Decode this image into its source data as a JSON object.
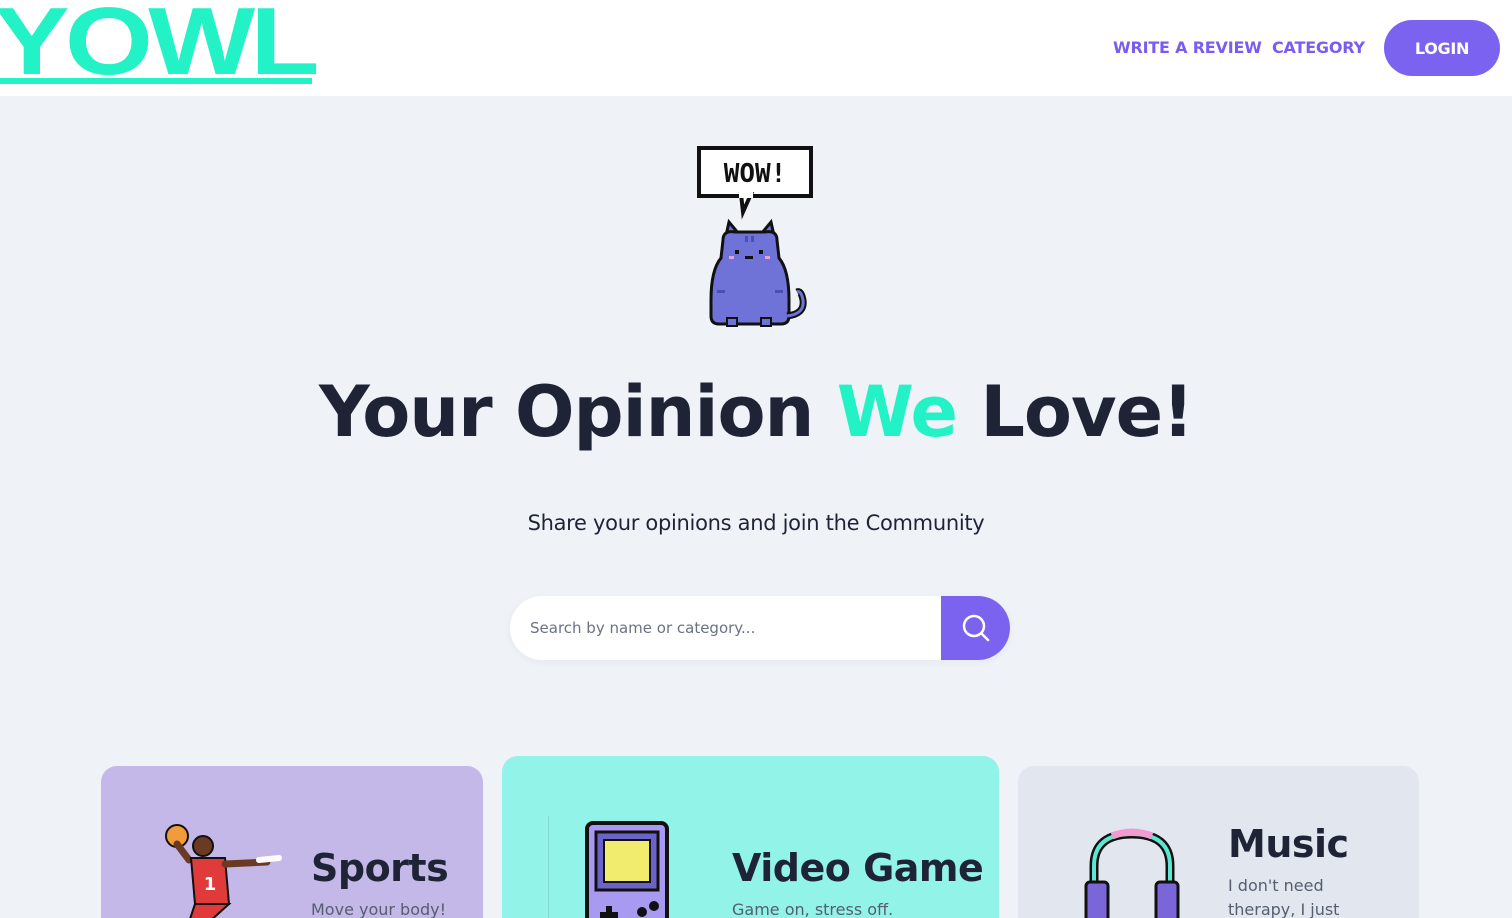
{
  "header": {
    "logo_text": "YOWL",
    "nav": {
      "write_review": "WRITE A REVIEW",
      "category": "CATEGORY"
    },
    "login_label": "LOGIN"
  },
  "hero": {
    "speech_bubble": "WOW!",
    "headline_before": "Your Opinion ",
    "headline_accent": "We",
    "headline_after": " Love!",
    "subtitle": "Share your opinions and join the Community"
  },
  "search": {
    "placeholder": "Search by name or category..."
  },
  "categories": [
    {
      "title": "Sports",
      "description": "Move your body!"
    },
    {
      "title": "Video Game",
      "description": "Game on, stress off."
    },
    {
      "title": "Music",
      "description": "I don't need therapy, I just"
    }
  ],
  "colors": {
    "brand": "#22f2c6",
    "accent": "#7b63f0",
    "text": "#1e2436",
    "page_bg": "#eff3f8"
  },
  "icons": {
    "search": "search-icon",
    "mascot": "pixel-cat-mascot",
    "sports": "basketball-player-icon",
    "video_game": "gameboy-icon",
    "music": "headphones-icon"
  }
}
